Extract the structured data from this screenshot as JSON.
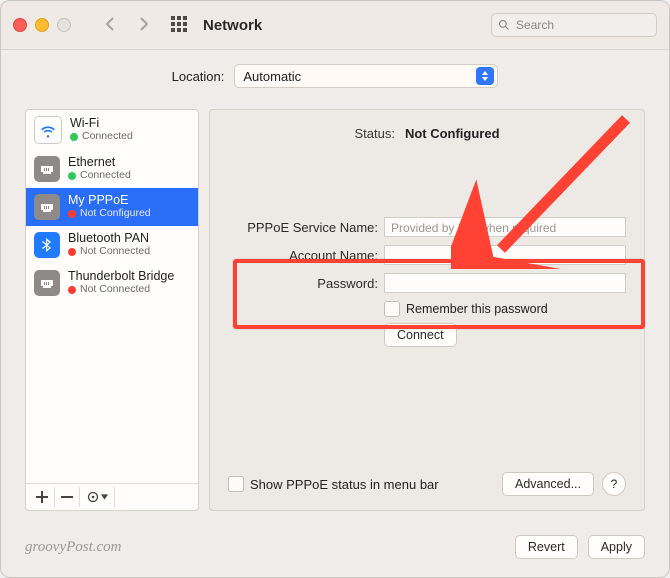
{
  "window_title": "Network",
  "search_placeholder": "Search",
  "location_label": "Location:",
  "location_value": "Automatic",
  "services": [
    {
      "name": "Wi-Fi",
      "status_text": "Connected",
      "status_color": "green",
      "icon": "wifi",
      "selected": false
    },
    {
      "name": "Ethernet",
      "status_text": "Connected",
      "status_color": "green",
      "icon": "ethernet",
      "selected": false
    },
    {
      "name": "My PPPoE",
      "status_text": "Not Configured",
      "status_color": "red",
      "icon": "ethernet",
      "selected": true
    },
    {
      "name": "Bluetooth PAN",
      "status_text": "Not Connected",
      "status_color": "red",
      "icon": "bluetooth",
      "selected": false
    },
    {
      "name": "Thunderbolt Bridge",
      "status_text": "Not Connected",
      "status_color": "red",
      "icon": "ethernet",
      "selected": false
    }
  ],
  "detail": {
    "status_label": "Status:",
    "status_value": "Not Configured",
    "pppoe_service_label": "PPPoE Service Name:",
    "pppoe_service_placeholder": "Provided by ISP when required",
    "account_label": "Account Name:",
    "account_value": "",
    "password_label": "Password:",
    "password_value": "",
    "remember_label": "Remember this password",
    "connect_label": "Connect",
    "show_status_label": "Show PPPoE status in menu bar",
    "advanced_label": "Advanced...",
    "help_label": "?"
  },
  "footer": {
    "watermark": "groovyPost.com",
    "revert": "Revert",
    "apply": "Apply"
  }
}
